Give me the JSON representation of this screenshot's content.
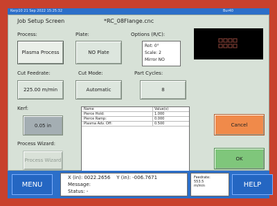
{
  "titlebar": {
    "left_text": "Kerp10  21 Sep 2022 15:25:32",
    "right_text": "Bur40"
  },
  "screen": {
    "title": "Job Setup Screen",
    "filename": "*RC_08Flange.cnc"
  },
  "process": {
    "label": "Process:",
    "value": "Plasma Process"
  },
  "plate": {
    "label": "Plate:",
    "value": "NO Plate"
  },
  "options": {
    "label": "Options (R/C):",
    "lines": [
      "Rot: 0°",
      "Scale: 2",
      "Mirror NO"
    ]
  },
  "cut_feedrate": {
    "label": "Cut Feedrate:",
    "value": "225.00 m/min"
  },
  "cut_mode": {
    "label": "Cut Mode:",
    "value": "Automatic"
  },
  "part_cycles": {
    "label": "Part Cycles:",
    "value": "8"
  },
  "kerf": {
    "label": "Kerf:",
    "value": "0.05 in"
  },
  "process_wizard": {
    "label": "Process Wizard:",
    "button": "Process Wizard"
  },
  "params_table": {
    "headers": [
      "Name",
      "Value(s)"
    ],
    "rows": [
      [
        "Pierce Hold:",
        "1.000"
      ],
      [
        "Pierce Ramp:",
        "0.000"
      ],
      [
        "Plasma Adv. Off:",
        "0.500"
      ]
    ]
  },
  "buttons": {
    "cancel": "Cancel",
    "ok": "OK",
    "menu": "MENU",
    "help": "HELP"
  },
  "status": {
    "x_text": "X (in): 0022.2656",
    "y_text": "Y (in): -006.7671",
    "message": "Message:",
    "status": "Status:  -"
  },
  "feedrate_box": {
    "label": "Feedrate:",
    "value": "553.5",
    "unit": "m/min"
  },
  "colors": {
    "frame": "#c8412d",
    "bar": "#2c6fc9",
    "cancel": "#f08a4a",
    "ok": "#7fc67b"
  },
  "icons": {
    "preview": "part-preview-image"
  }
}
